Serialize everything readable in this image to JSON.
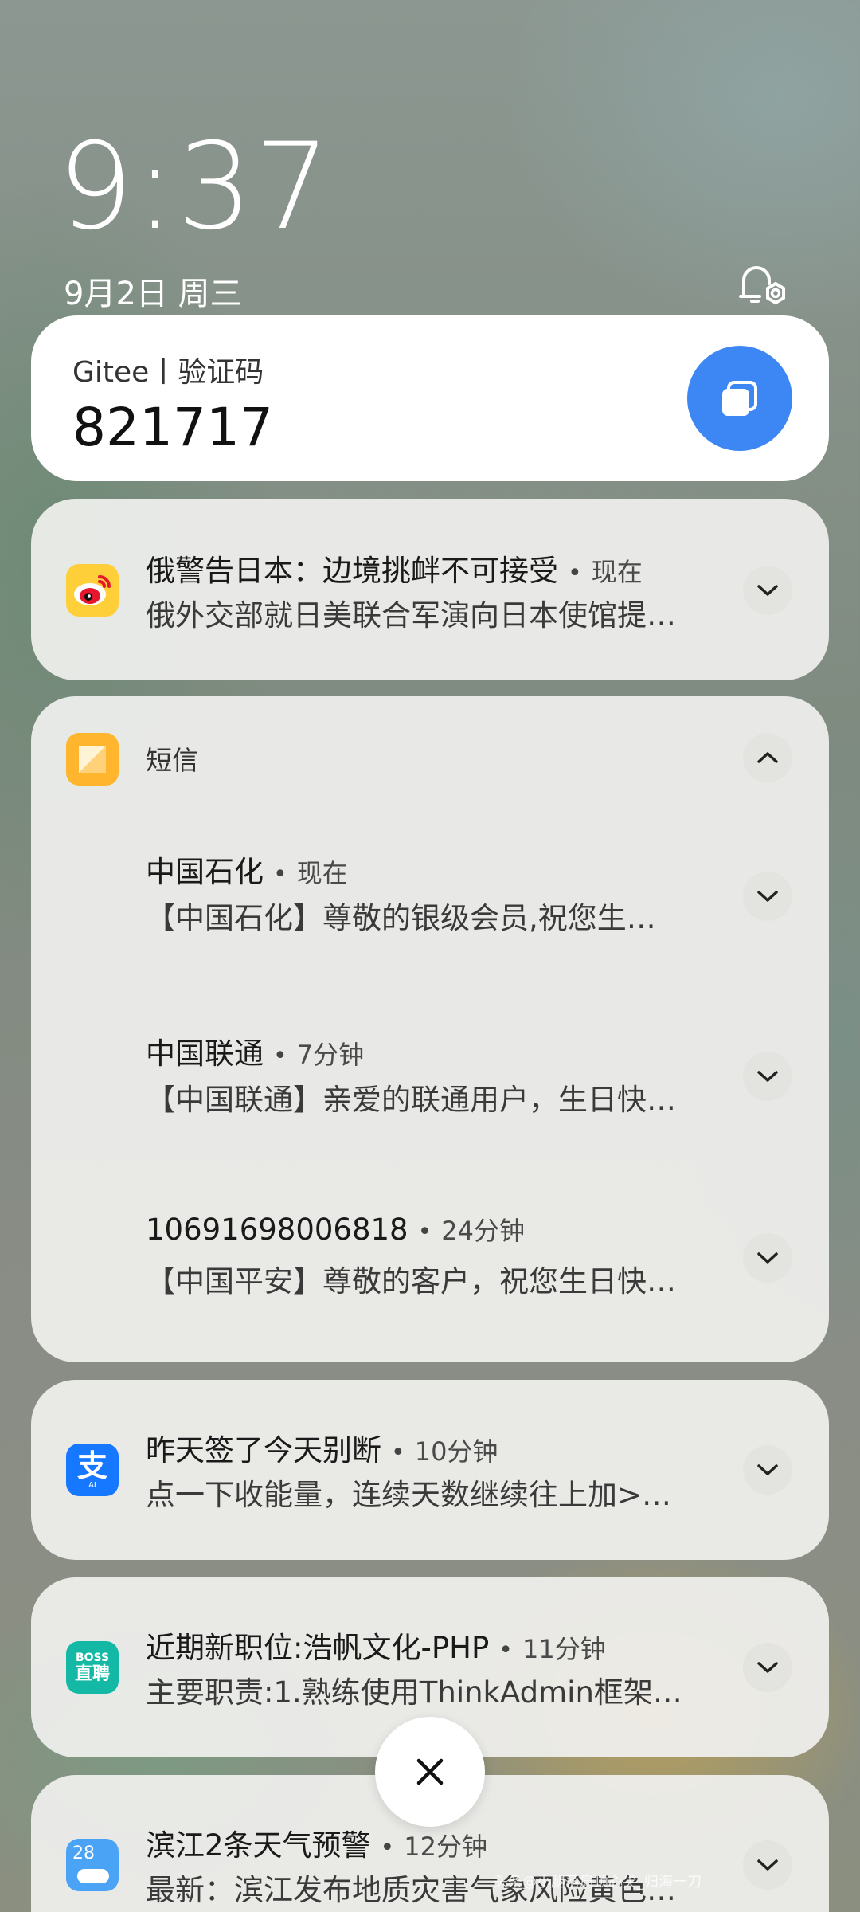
{
  "lockscreen": {
    "time": "9:37",
    "date": "9月2日 周三"
  },
  "otp": {
    "title": "Gitee丨验证码",
    "code": "821717",
    "copy_icon": "copy-icon"
  },
  "weibo": {
    "title": "俄警告日本：边境挑衅不可接受",
    "time": "现在",
    "body": "俄外交部就日美联合军演向日本使馆提…",
    "icon": "weibo-icon"
  },
  "sms_group": {
    "app": "短信",
    "icon": "messages-icon",
    "messages": [
      {
        "sender": "中国石化",
        "time": "现在",
        "body": "【中国石化】尊敬的银级会员,祝您生…"
      },
      {
        "sender": "中国联通",
        "time": "7分钟",
        "body": "【中国联通】亲爱的联通用户，生日快…"
      },
      {
        "sender": "10691698006818",
        "time": "24分钟",
        "body": "【中国平安】尊敬的客户，祝您生日快…"
      }
    ]
  },
  "alipay": {
    "title": "昨天签了今天别断",
    "time": "10分钟",
    "body": "点一下收能量，连续天数继续往上加>…",
    "icon": "alipay-icon",
    "icon_glyph": "支",
    "icon_sub": "AI"
  },
  "boss": {
    "title": "近期新职位:浩帆文化-PHP",
    "time": "11分钟",
    "body": "主要职责:1.熟练使用ThinkAdmin框架…",
    "icon": "boss-zhipin-icon",
    "icon_line1": "BOSS",
    "icon_line2": "直聘"
  },
  "weather": {
    "title": "滨江2条天气预警",
    "time": "12分钟",
    "body": "最新：滨江发布地质灾害气象风险黄色…",
    "icon": "weather-icon",
    "icon_num": "28"
  },
  "watermark": "头条@小腿落肩顶心尖_归海一刀",
  "colors": {
    "accent": "#3d87f5",
    "weibo_bg": "#ffcf3a",
    "sms_bg": "#ffb52e",
    "alipay_bg": "#1677ff",
    "boss_bg": "#14b9a5",
    "weather_bg": "#4aa3f5"
  }
}
